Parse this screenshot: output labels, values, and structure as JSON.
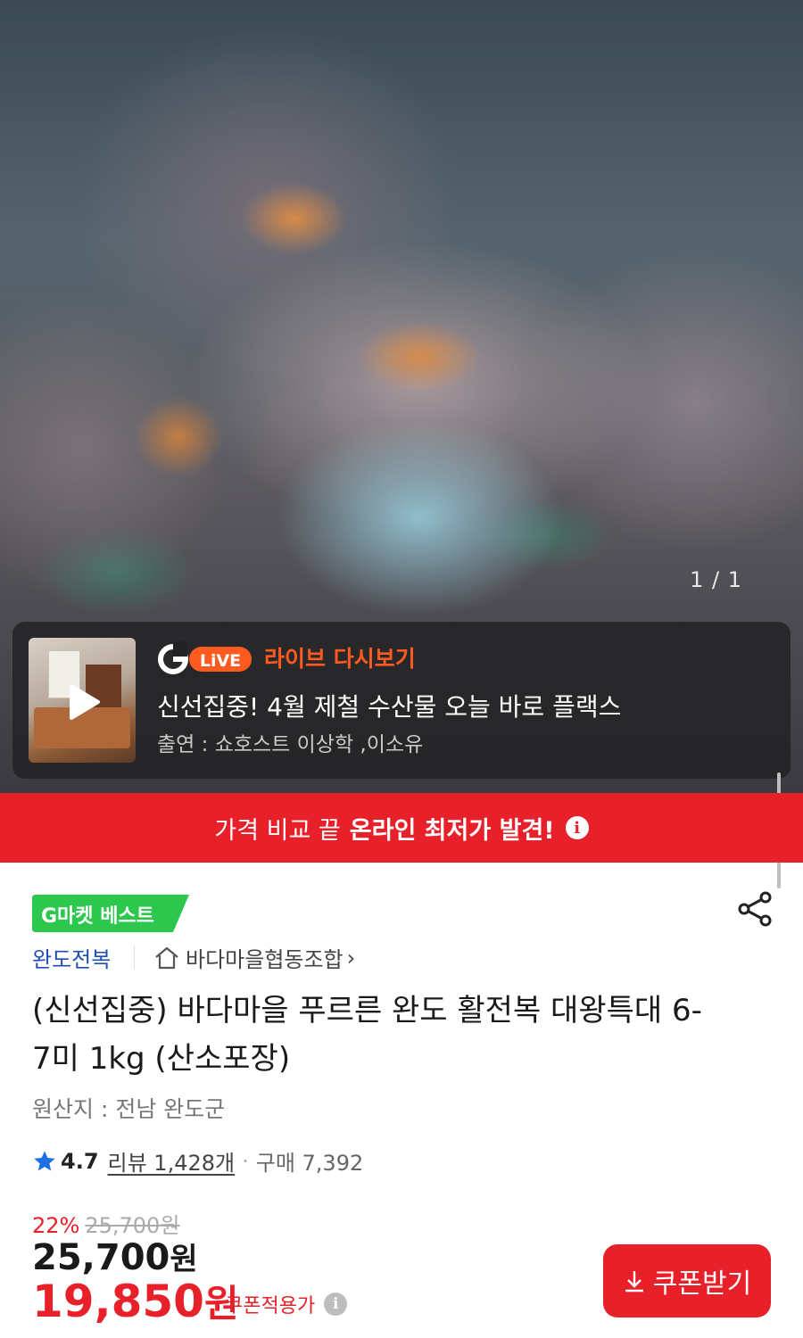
{
  "hero": {
    "image_desc_icon": "abalone-photo",
    "counter": "1 / 1"
  },
  "live": {
    "logo_text": "LiVE",
    "logo_letter": "G",
    "title": "라이브 다시보기",
    "description": "신선집중! 4월 제철 수산물 오늘 바로 플랙스",
    "cast": "출연 : 쇼호스트 이상학 ,이소유"
  },
  "promo": {
    "text_normal": "가격 비교 끝",
    "text_strong": "온라인 최저가 발견!",
    "info": "i"
  },
  "badge": {
    "label": "G마켓 베스트"
  },
  "brand": {
    "label": "완도전복"
  },
  "store": {
    "label": "바다마을협동조합",
    "chevron": "›"
  },
  "product": {
    "title": "(신선집중) 바다마을 푸르른 완도 활전복 대왕특대 6-7미 1kg (산소포장)",
    "origin": "원산지 : 전남 완도군"
  },
  "rating": {
    "score": "4.7",
    "review": "리뷰 1,428개",
    "dot": "·",
    "purchase": "구매 7,392"
  },
  "price": {
    "discount_rate": "22%",
    "original": "25,700원",
    "main_number": "25,700",
    "unit": "원",
    "coupon_number": "19,850",
    "coupon_label": "쿠폰적용가",
    "info": "i"
  },
  "coupon_button": {
    "label": "쿠폰받기"
  },
  "colors": {
    "accent_red": "#e8202a",
    "live_orange": "#ff5a1f",
    "badge_green": "#2cc84d",
    "brand_blue": "#1f4fb5"
  }
}
